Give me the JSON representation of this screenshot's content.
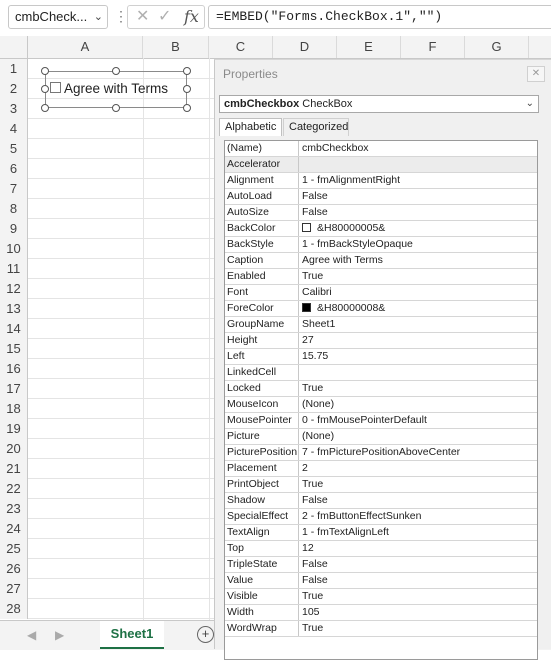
{
  "formula_bar": {
    "name_box": "cmbCheck...",
    "formula": "=EMBED(\"Forms.CheckBox.1\",\"\")"
  },
  "grid": {
    "columns": [
      "A",
      "B",
      "C",
      "D",
      "E",
      "F",
      "G"
    ],
    "rows": [
      "1",
      "2",
      "3",
      "4",
      "5",
      "6",
      "7",
      "8",
      "9",
      "10",
      "11",
      "12",
      "13",
      "14",
      "15",
      "16",
      "17",
      "18",
      "19",
      "20",
      "21",
      "22",
      "23",
      "24",
      "25",
      "26",
      "27",
      "28"
    ]
  },
  "checkbox_control": {
    "caption": "Agree with Terms"
  },
  "sheet_tabs": {
    "active": "Sheet1"
  },
  "properties": {
    "title": "Properties",
    "object_name": "cmbCheckbox",
    "object_type": "CheckBox",
    "tabs": [
      "Alphabetic",
      "Categorized"
    ],
    "colors": {
      "BackColor": "#ffffff",
      "ForeColor": "#000000"
    },
    "rows": [
      {
        "name": "(Name)",
        "value": "cmbCheckbox"
      },
      {
        "name": "Accelerator",
        "value": ""
      },
      {
        "name": "Alignment",
        "value": "1 - fmAlignmentRight"
      },
      {
        "name": "AutoLoad",
        "value": "False"
      },
      {
        "name": "AutoSize",
        "value": "False"
      },
      {
        "name": "BackColor",
        "value": "&H80000005&"
      },
      {
        "name": "BackStyle",
        "value": "1 - fmBackStyleOpaque"
      },
      {
        "name": "Caption",
        "value": "Agree with Terms"
      },
      {
        "name": "Enabled",
        "value": "True"
      },
      {
        "name": "Font",
        "value": "Calibri"
      },
      {
        "name": "ForeColor",
        "value": "&H80000008&"
      },
      {
        "name": "GroupName",
        "value": "Sheet1"
      },
      {
        "name": "Height",
        "value": "27"
      },
      {
        "name": "Left",
        "value": "15.75"
      },
      {
        "name": "LinkedCell",
        "value": ""
      },
      {
        "name": "Locked",
        "value": "True"
      },
      {
        "name": "MouseIcon",
        "value": "(None)"
      },
      {
        "name": "MousePointer",
        "value": "0 - fmMousePointerDefault"
      },
      {
        "name": "Picture",
        "value": "(None)"
      },
      {
        "name": "PicturePosition",
        "value": "7 - fmPicturePositionAboveCenter"
      },
      {
        "name": "Placement",
        "value": "2"
      },
      {
        "name": "PrintObject",
        "value": "True"
      },
      {
        "name": "Shadow",
        "value": "False"
      },
      {
        "name": "SpecialEffect",
        "value": "2 - fmButtonEffectSunken"
      },
      {
        "name": "TextAlign",
        "value": "1 - fmTextAlignLeft"
      },
      {
        "name": "Top",
        "value": "12"
      },
      {
        "name": "TripleState",
        "value": "False"
      },
      {
        "name": "Value",
        "value": "False"
      },
      {
        "name": "Visible",
        "value": "True"
      },
      {
        "name": "Width",
        "value": "105"
      },
      {
        "name": "WordWrap",
        "value": "True"
      }
    ]
  }
}
